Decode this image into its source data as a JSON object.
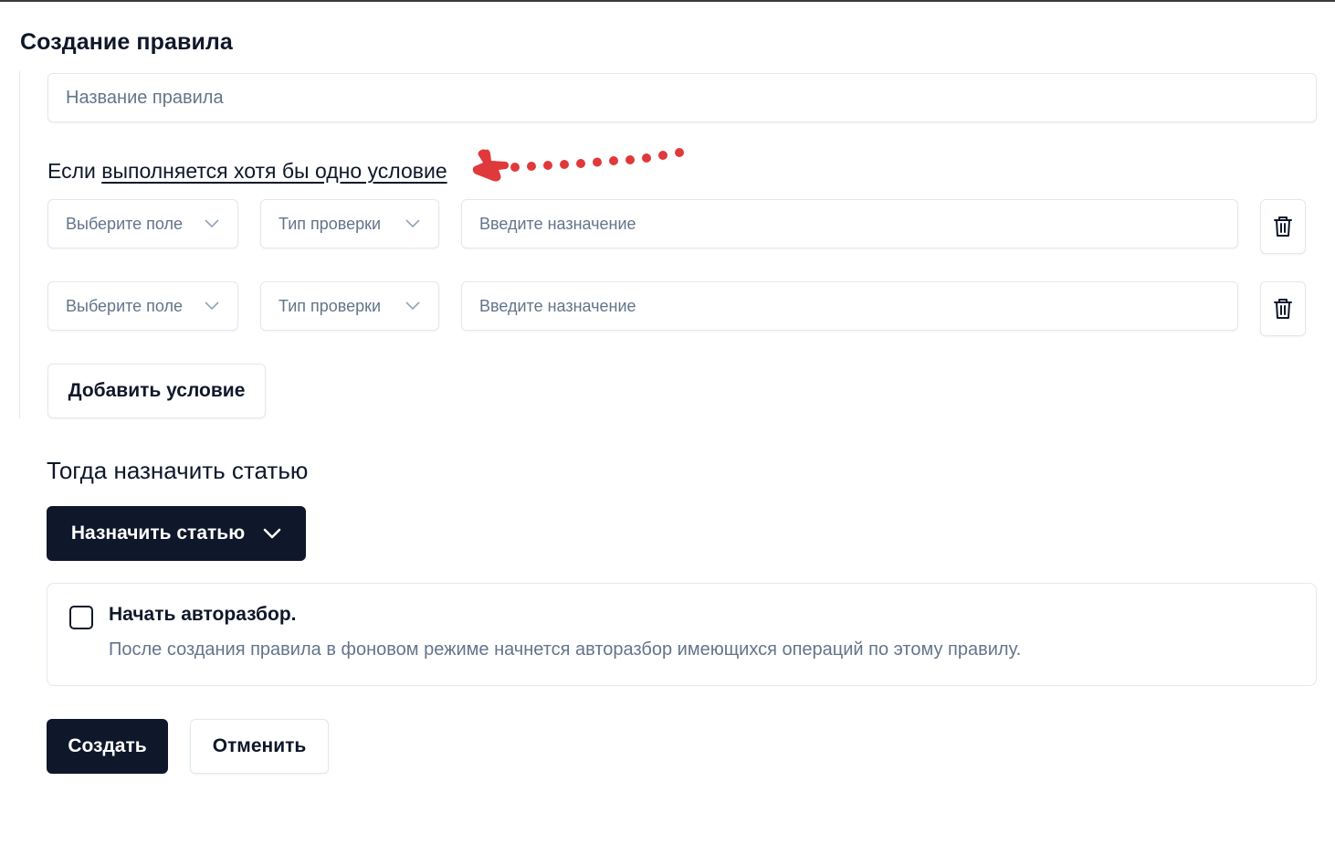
{
  "page": {
    "title": "Создание правила"
  },
  "rule_name": {
    "placeholder": "Название правила"
  },
  "conditions": {
    "prefix": "Если",
    "mode_link": "выполняется хотя бы одно условие",
    "rows": [
      {
        "field": "Выберите поле",
        "check_type": "Тип проверки",
        "destination": "Введите назначение"
      },
      {
        "field": "Выберите поле",
        "check_type": "Тип проверки",
        "destination": "Введите назначение"
      }
    ],
    "add_label": "Добавить условие"
  },
  "action": {
    "title": "Тогда назначить статью",
    "assign_label": "Назначить статью"
  },
  "auto_parse": {
    "checked": false,
    "title": "Начать авторазбор.",
    "description": "После создания правила в фоновом режиме начнется авторазбор имеющихся операций по этому правилу."
  },
  "footer": {
    "create_label": "Создать",
    "cancel_label": "Отменить"
  },
  "colors": {
    "primary": "#0f172a",
    "muted_text": "#64748b",
    "border": "#e2e8f0",
    "annotation_red": "#e0393b"
  }
}
